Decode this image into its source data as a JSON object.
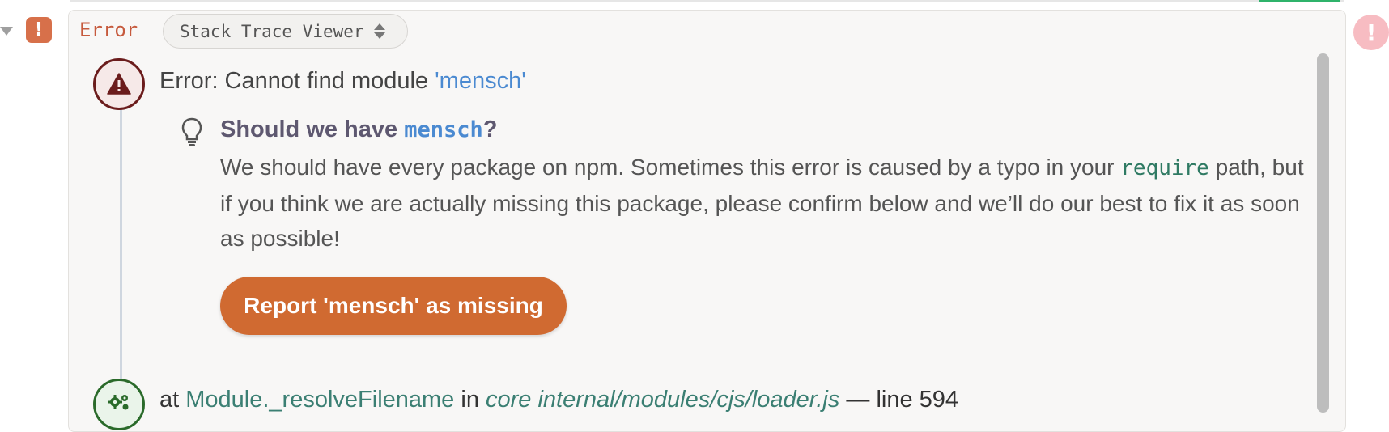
{
  "cell": {
    "error_label": "Error",
    "viewer_label": "Stack Trace Viewer"
  },
  "error": {
    "prefix": "Error: Cannot find module ",
    "module": "'mensch'"
  },
  "suggestion": {
    "title_prefix": "Should we have ",
    "package": "mensch",
    "title_suffix": "?",
    "body_part1": "We should have every package on npm. Sometimes this error is caused by a typo in your ",
    "body_code": "require",
    "body_part2": " path, but if you think we are actually missing this package, please confirm below and we’ll do our best to fix it as soon as possible!",
    "button_label": "Report 'mensch' as missing"
  },
  "frame": {
    "at": "at ",
    "function": "Module._resolveFilename",
    "in": " in ",
    "file": "core internal/modules/cjs/loader.js",
    "line_text": " — line 594"
  },
  "colors": {
    "error_accent": "#d7704a",
    "link_blue": "#4b8ad1",
    "button": "#d06a31",
    "code_green": "#2f7a63"
  },
  "icons": {
    "collapse": "triangle-down-icon",
    "error_badge": "exclamation-icon",
    "warning": "warning-triangle-icon",
    "lightbulb": "lightbulb-icon",
    "gears": "gears-icon",
    "right_alert": "exclamation-circle-icon",
    "viewer_caret": "sort-caret-icon"
  }
}
